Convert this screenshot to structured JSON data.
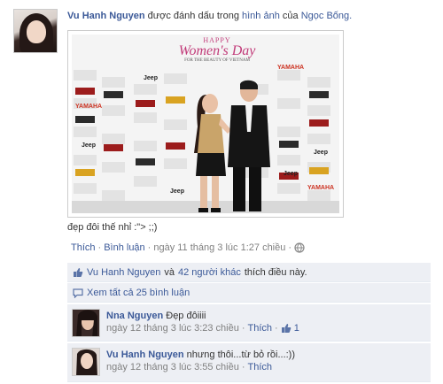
{
  "post": {
    "author": "Vu Hanh Nguyen",
    "tagged_text": "được đánh dấu trong",
    "photo_link": "hình ảnh",
    "of_text": "của",
    "owner": "Ngọc Bống.",
    "caption": "đẹp đôi thế nhỉ :\"> ;;)",
    "photo": {
      "banner_line1": "HAPPY",
      "banner_line2": "Women's Day",
      "banner_line3": "FOR THE BEAUTY OF VIETNAM",
      "sponsor_logos": [
        "Jeep",
        "YAMAHA",
        "Jeep",
        "YAMAHA",
        "Jeep",
        "YAMAHA",
        "Jeep",
        "Jeep"
      ]
    }
  },
  "actions": {
    "like": "Thích",
    "comment": "Bình luận",
    "sep": "·",
    "timestamp": "ngày 11 tháng 3 lúc 1:27 chiều",
    "privacy_icon": "globe-icon"
  },
  "likes": {
    "icon": "thumbs-up-icon",
    "name": "Vu Hanh Nguyen",
    "and": "và",
    "others": "42 người khác",
    "rest": "thích điều này."
  },
  "view_all": {
    "icon": "comment-icon",
    "label": "Xem tất cả 25 bình luận"
  },
  "comments": [
    {
      "author": "Nna Nguyen",
      "text": "Đẹp đôiiii",
      "time": "ngày 12 tháng 3 lúc 3:23 chiều",
      "like": "Thích",
      "like_count": "1"
    },
    {
      "author": "Vu Hanh Nguyen",
      "text": "nhưng thôi...từ bỏ rồi...:))",
      "time": "ngày 12 tháng 3 lúc 3:55 chiều",
      "like": "Thích"
    }
  ],
  "colors": {
    "link": "#3b5998",
    "muted": "#808080",
    "box_bg": "#edeff4",
    "banner": "#c23c7a"
  }
}
